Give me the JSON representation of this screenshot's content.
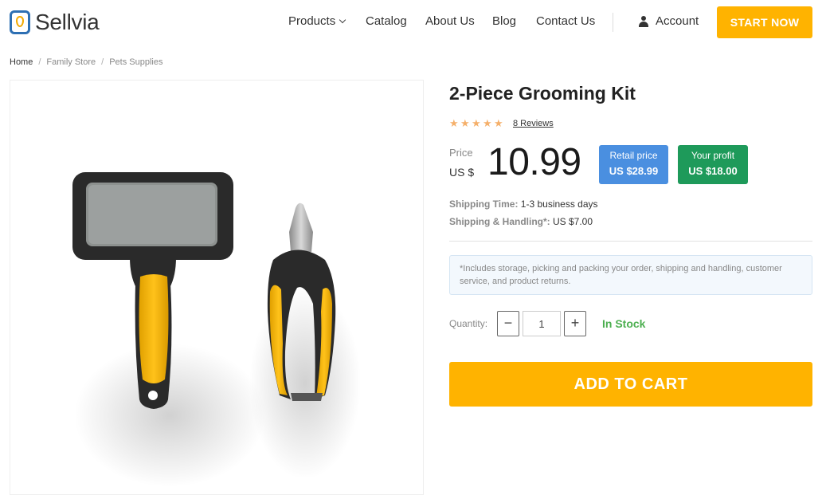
{
  "brand": {
    "name": "Sellvia",
    "logo_icon": "map-pin-logo-icon",
    "primary_color": "#2d6fb3",
    "accent_color": "#ffb300"
  },
  "nav": {
    "items": [
      {
        "label": "Products",
        "has_dropdown": true
      },
      {
        "label": "Catalog"
      },
      {
        "label": "About Us"
      },
      {
        "label": "Blog"
      },
      {
        "label": "Contact Us"
      }
    ],
    "account_label": "Account",
    "cta_label": "START NOW"
  },
  "breadcrumb": [
    "Home",
    "Family Store",
    "Pets Supplies"
  ],
  "breadcrumb_sep": "/",
  "product": {
    "title": "2-Piece Grooming Kit",
    "rating": 5,
    "rating_color": "#f5b06b",
    "reviews_label": "8 Reviews",
    "price_label": "Price",
    "currency": "US $",
    "price": "10.99",
    "retail": {
      "label": "Retail price",
      "value": "US $28.99",
      "color": "#4a8fe0"
    },
    "profit": {
      "label": "Your profit",
      "value": "US $18.00",
      "color": "#1e9a5a"
    },
    "shipping_time": {
      "label": "Shipping Time:",
      "value": "1-3 business days"
    },
    "shipping_handling": {
      "label": "Shipping & Handling*:",
      "value": "US $7.00"
    },
    "note": "*Includes storage, picking and packing your order, shipping and handling, customer service, and product returns.",
    "quantity_label": "Quantity:",
    "quantity": "1",
    "minus": "−",
    "plus": "+",
    "stock_label": "In Stock",
    "stock_color": "#4caf50",
    "add_to_cart": "ADD TO CART"
  }
}
